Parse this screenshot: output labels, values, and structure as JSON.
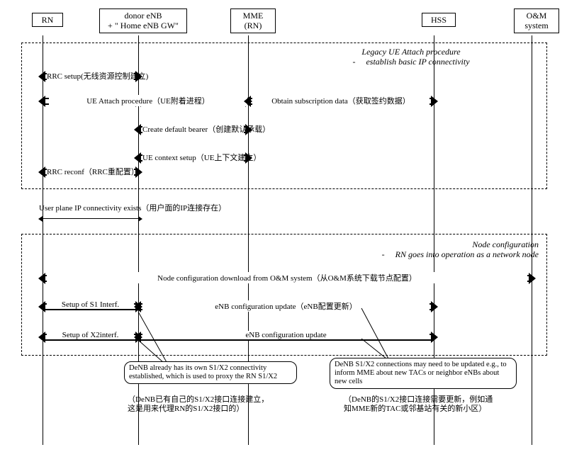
{
  "actors": {
    "rn": "RN",
    "denb_l1": "donor eNB",
    "denb_l2": "+ \" Home eNB GW\"",
    "mme_l1": "MME",
    "mme_l2": "(RN)",
    "hss": "HSS",
    "om_l1": "O&M",
    "om_l2": "system"
  },
  "phase1": {
    "title": "Legacy UE Attach procedure",
    "sub": "establish basic IP connectivity"
  },
  "phase2": {
    "title": "Node configuration",
    "sub": "RN goes into operation as a network node"
  },
  "arrows": {
    "rrc_setup": "RRC setup(无线资源控制建立)",
    "ue_attach": "UE Attach procedure（UE附着进程）",
    "obtain_sub": "Obtain subscription data（获取签约数据）",
    "create_bearer": "Create default bearer（创建默认承载）",
    "ue_context": "UE context setup（UE上下文建立）",
    "rrc_reconf": "RRC reconf（RRC重配置）",
    "user_plane": "User plane IP connectivity exists（用户面的IP连接存在）",
    "node_config": "Node configuration download from O&M system（从O&M系统下载节点配置）",
    "setup_s1": "Setup of S1 Interf.",
    "enb_update1": "eNB configuration update（eNB配置更新）",
    "setup_x2": "Setup of X2interf.",
    "enb_update2": "eNB    configuration update"
  },
  "callouts": {
    "c1": "DeNB    already has its own S1/X2 connectivity established, which is used to proxy the RN S1/X2",
    "c1_cn": "（DeNB已有自己的S1/X2接口连接建立，这是用来代理RN的S1/X2接口的）",
    "c2": "DeNB    S1/X2 connections may need to be updated e.g., to inform MME about new TACs   or neighbor eNBs   about new cells",
    "c2_cn": "（DeNB的S1/X2接口连接需要更新，例如通知MME新的TAC或邻基站有关的新小区）"
  }
}
